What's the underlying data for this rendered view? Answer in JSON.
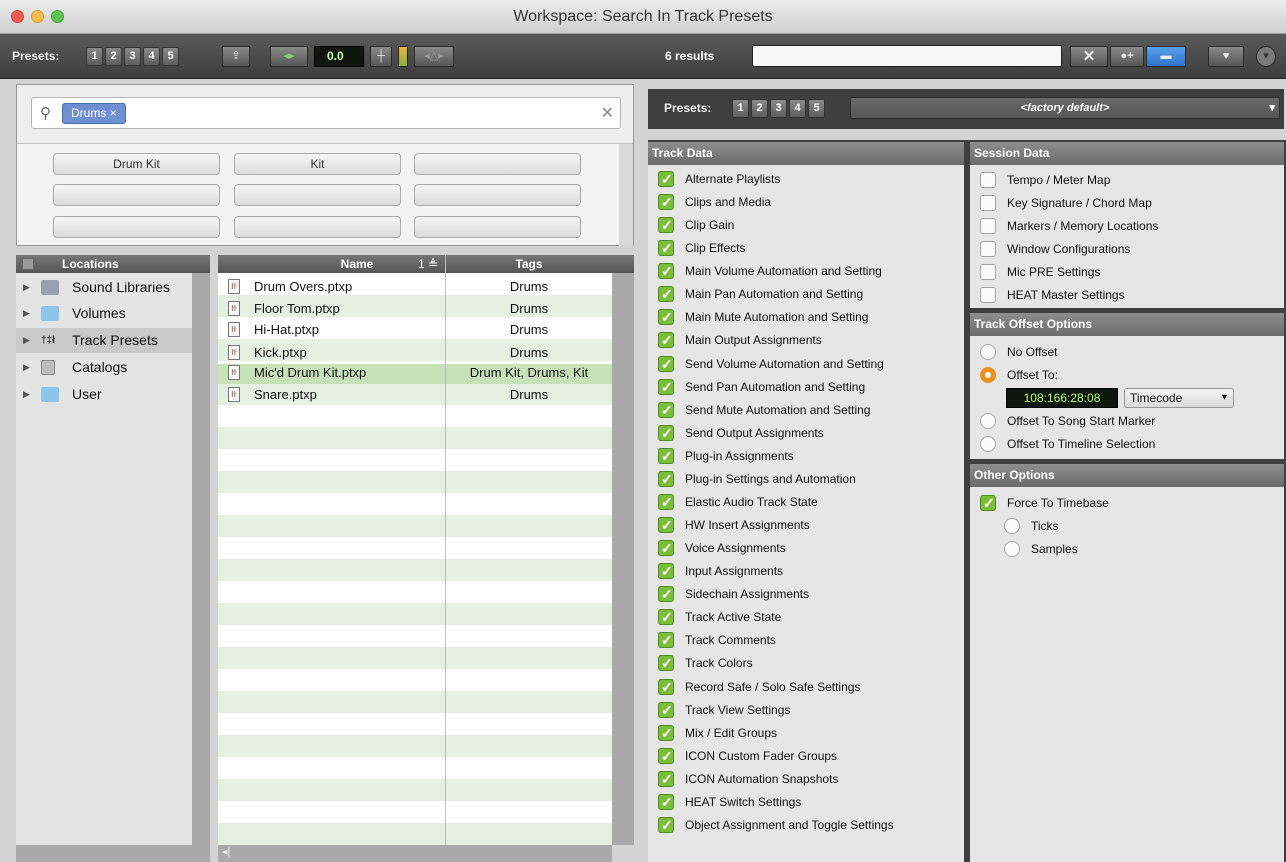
{
  "window": {
    "title": "Workspace: Search In Track Presets"
  },
  "toolbar": {
    "presets_label": "Presets:",
    "preset_numbers": [
      "1",
      "2",
      "3",
      "4",
      "5"
    ],
    "volume_value": "0.0",
    "results_text": "6 results",
    "search_value": ""
  },
  "search": {
    "token": "Drums ×"
  },
  "tags": [
    "Drum Kit",
    "Kit",
    "",
    "",
    "",
    "",
    "",
    "",
    ""
  ],
  "locations": {
    "header": "Locations",
    "items": [
      {
        "label": "Sound Libraries",
        "icon": "waveform-icon"
      },
      {
        "label": "Volumes",
        "icon": "folder-icon"
      },
      {
        "label": "Track Presets",
        "icon": "track-preset-icon"
      },
      {
        "label": "Catalogs",
        "icon": "catalog-icon"
      },
      {
        "label": "User",
        "icon": "folder-icon"
      }
    ],
    "selected": "Track Presets"
  },
  "files": {
    "headers": {
      "name": "Name",
      "sort": "1 ≜",
      "tags": "Tags"
    },
    "rows": [
      {
        "name": "Drum Overs.ptxp",
        "tags": "Drums"
      },
      {
        "name": "Floor Tom.ptxp",
        "tags": "Drums"
      },
      {
        "name": "Hi-Hat.ptxp",
        "tags": "Drums"
      },
      {
        "name": "Kick.ptxp",
        "tags": "Drums"
      },
      {
        "name": "Mic'd Drum Kit.ptxp",
        "tags": "Drum Kit, Drums, Kit"
      },
      {
        "name": "Snare.ptxp",
        "tags": "Drums"
      }
    ],
    "selected_index": 4
  },
  "right_presets": {
    "label": "Presets:",
    "numbers": [
      "1",
      "2",
      "3",
      "4",
      "5"
    ],
    "dropdown": "<factory default>"
  },
  "track_data": {
    "header": "Track Data",
    "items": [
      "Alternate Playlists",
      "Clips and Media",
      "Clip Gain",
      "Clip Effects",
      "Main Volume Automation and Setting",
      "Main Pan Automation and Setting",
      "Main Mute Automation and Setting",
      "Main Output Assignments",
      "Send Volume Automation and Setting",
      "Send Pan Automation and Setting",
      "Send Mute Automation and Setting",
      "Send Output Assignments",
      "Plug-in Assignments",
      "Plug-in Settings and Automation",
      "Elastic Audio Track State",
      "HW Insert Assignments",
      "Voice Assignments",
      "Input Assignments",
      "Sidechain Assignments",
      "Track Active State",
      "Track Comments",
      "Track Colors",
      "Record Safe / Solo Safe Settings",
      "Track View Settings",
      "Mix / Edit Groups",
      "ICON Custom Fader Groups",
      "ICON Automation Snapshots",
      "HEAT Switch Settings",
      "Object Assignment and Toggle Settings"
    ]
  },
  "session_data": {
    "header": "Session Data",
    "items": [
      "Tempo / Meter Map",
      "Key Signature / Chord Map",
      "Markers / Memory Locations",
      "Window Configurations",
      "Mic PRE Settings",
      "HEAT Master Settings"
    ]
  },
  "offset_options": {
    "header": "Track Offset Options",
    "no_offset": "No Offset",
    "offset_to": "Offset To:",
    "timecode_value": "108:166:28:08",
    "timecode_format": "Timecode",
    "song_start": "Offset To Song Start Marker",
    "timeline_sel": "Offset To Timeline Selection"
  },
  "other_options": {
    "header": "Other Options",
    "force": "Force To Timebase",
    "ticks": "Ticks",
    "samples": "Samples"
  },
  "colors": {
    "accent_green": "#7cbd3c",
    "selected_row": "#c7e2b9",
    "token_blue": "#6e8fd0",
    "radio_orange": "#f08f20"
  }
}
